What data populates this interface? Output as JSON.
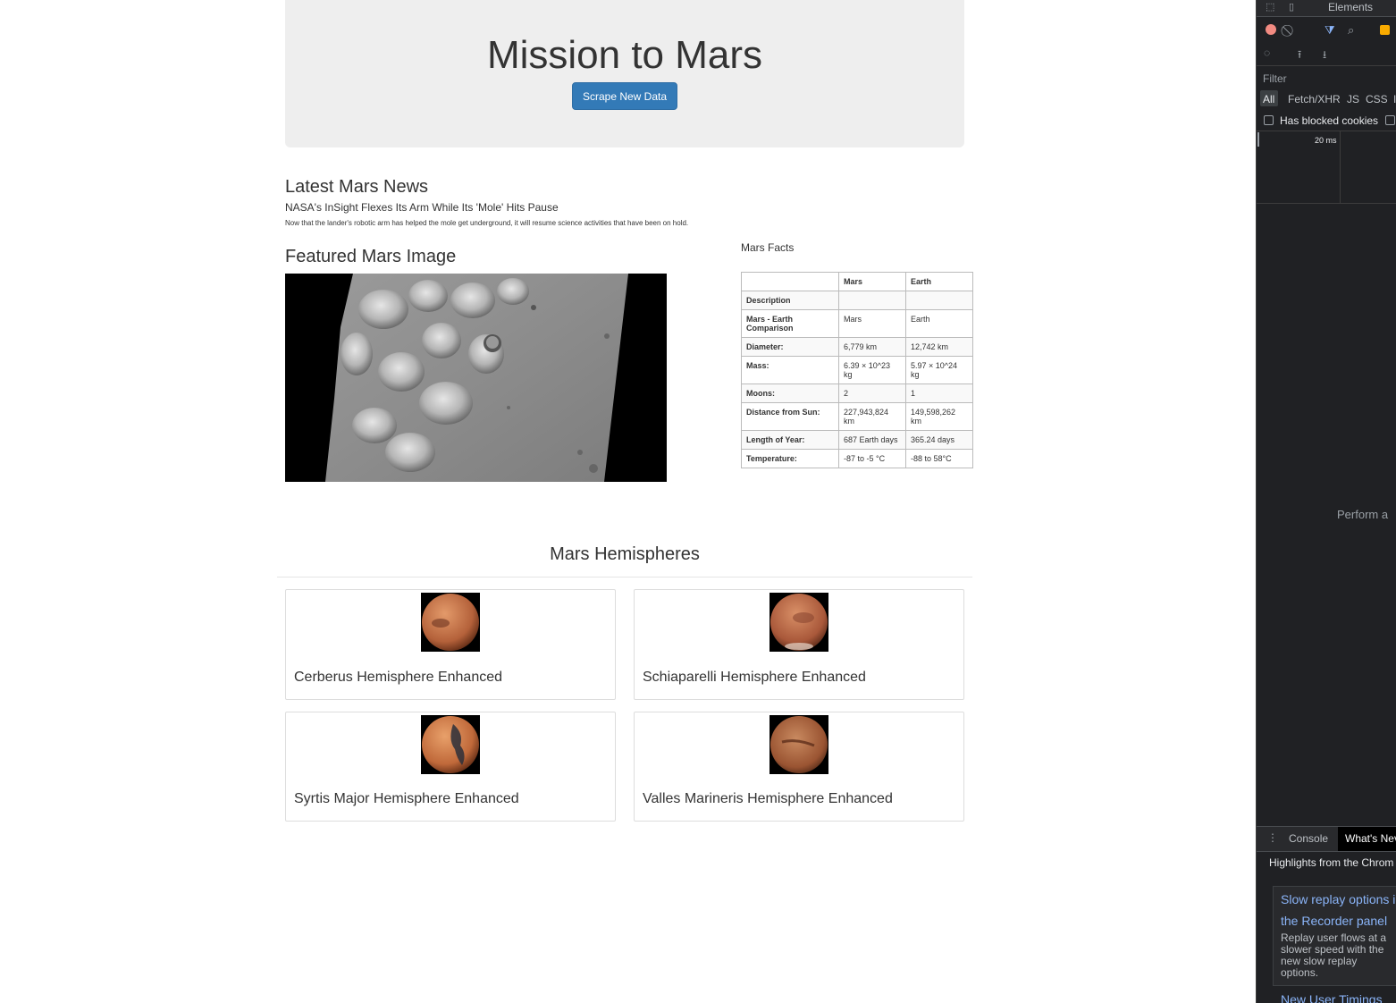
{
  "jumbotron": {
    "title": "Mission to Mars",
    "scrape_button": "Scrape New Data"
  },
  "news": {
    "heading": "Latest Mars News",
    "title": "NASA's InSight Flexes Its Arm While Its 'Mole' Hits Pause",
    "paragraph": "Now that the lander's robotic arm has helped the mole get underground, it will resume science activities that have been on hold."
  },
  "featured": {
    "heading": "Featured Mars Image"
  },
  "facts": {
    "caption": "Mars Facts",
    "columns": [
      "",
      "Mars",
      "Earth"
    ],
    "rows": [
      {
        "label": "Description",
        "mars": "",
        "earth": ""
      },
      {
        "label": "Mars - Earth Comparison",
        "mars": "Mars",
        "earth": "Earth"
      },
      {
        "label": "Diameter:",
        "mars": "6,779 km",
        "earth": "12,742 km"
      },
      {
        "label": "Mass:",
        "mars": "6.39 × 10^23 kg",
        "earth": "5.97 × 10^24 kg"
      },
      {
        "label": "Moons:",
        "mars": "2",
        "earth": "1"
      },
      {
        "label": "Distance from Sun:",
        "mars": "227,943,824 km",
        "earth": "149,598,262 km"
      },
      {
        "label": "Length of Year:",
        "mars": "687 Earth days",
        "earth": "365.24 days"
      },
      {
        "label": "Temperature:",
        "mars": "-87 to -5 °C",
        "earth": "-88 to 58°C"
      }
    ]
  },
  "hemispheres": {
    "heading": "Mars Hemispheres",
    "items": [
      {
        "title": "Cerberus Hemisphere Enhanced"
      },
      {
        "title": "Schiaparelli Hemisphere Enhanced"
      },
      {
        "title": "Syrtis Major Hemisphere Enhanced"
      },
      {
        "title": "Valles Marineris Hemisphere Enhanced"
      }
    ]
  },
  "devtools": {
    "tabs": {
      "elements": "Elements"
    },
    "filter_label": "Filter",
    "type_filters": [
      "All",
      "Fetch/XHR",
      "JS",
      "CSS",
      "I"
    ],
    "blocked_cookies": "Has blocked cookies",
    "timeline_tick": "20 ms",
    "perform_text": "Perform a",
    "drawer_tabs": {
      "console": "Console",
      "whats_new": "What's Nev"
    },
    "highlights": "Highlights from the Chrom",
    "item1_title_a": "Slow replay options i",
    "item1_title_b": "the Recorder panel",
    "item1_desc": [
      "Replay user flows at a",
      "slower speed with the",
      "new slow replay",
      "options."
    ],
    "item2_title": "New User Timings"
  }
}
